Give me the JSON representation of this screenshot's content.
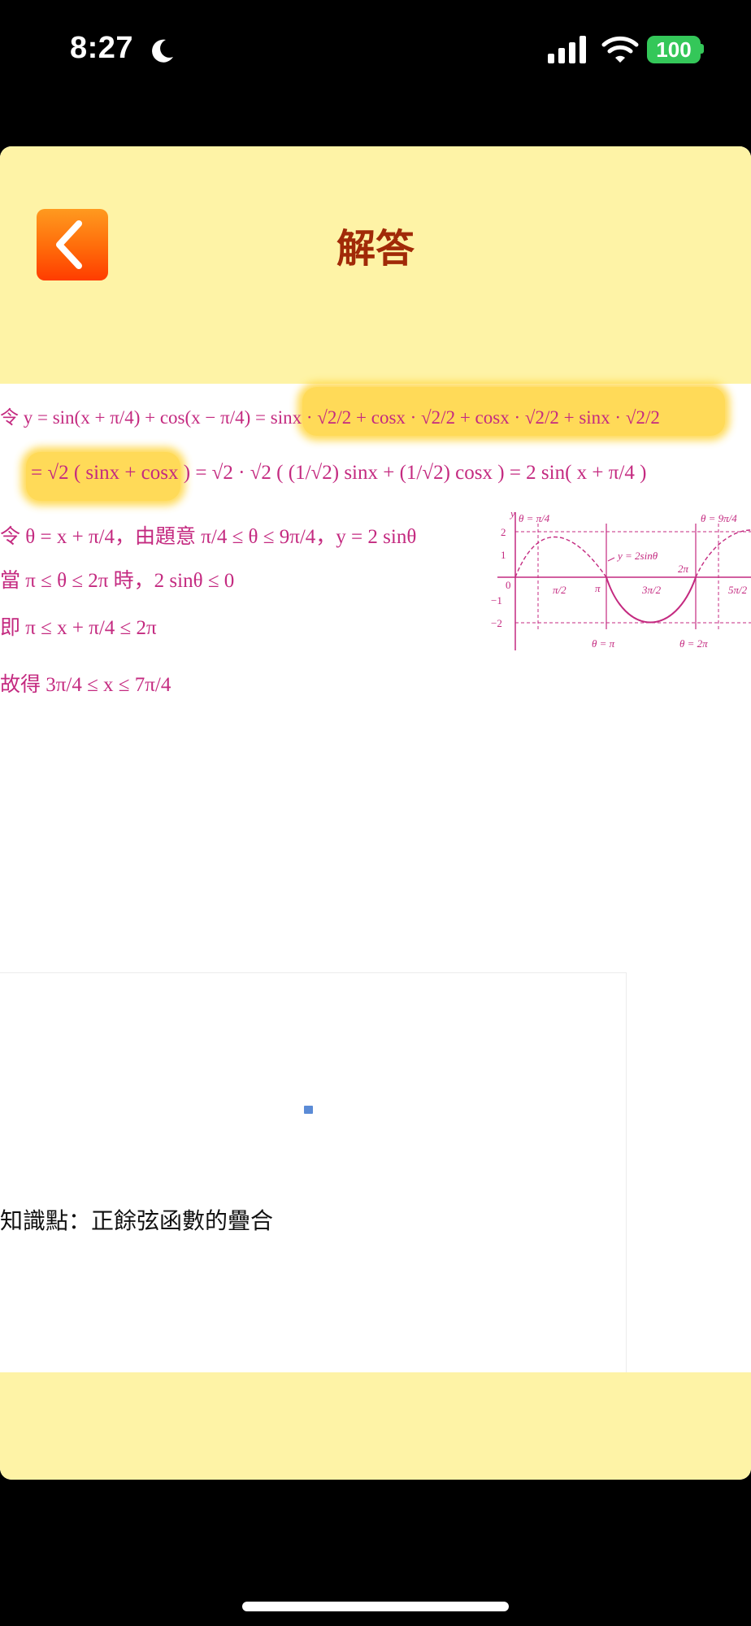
{
  "status_bar": {
    "time": "8:27",
    "battery": "100"
  },
  "header": {
    "title": "解答"
  },
  "solution": {
    "line1_lead": "令",
    "line1": "y = sin(x + π/4) + cos(x − π/4) = sinx · √2/2 + cosx · √2/2 + cosx · √2/2 + sinx · √2/2",
    "line2": "= √2 ( sinx + cosx ) = √2 · √2 ( (1/√2) sinx + (1/√2) cosx ) = 2 sin( x + π/4 )",
    "line3_lead": "令",
    "line3": "θ = x + π/4，由題意 π/4 ≤ θ ≤ 9π/4，y = 2 sinθ",
    "line4_lead": "當",
    "line4": "π ≤ θ ≤ 2π 時，2 sinθ ≤ 0",
    "line5_lead": "即",
    "line5": "π ≤ x + π/4 ≤ 2π",
    "line6_lead": "故得",
    "line6": "3π/4 ≤ x ≤ 7π/4"
  },
  "graph": {
    "y_axis": "y",
    "curve_label": "y = 2sinθ",
    "theta_top_left": "θ = π/4",
    "theta_top_right": "θ = 9π/4",
    "theta_bottom_left": "θ = π",
    "theta_bottom_right": "θ = 2π",
    "ticks_y": [
      "2",
      "1",
      "0",
      "−1",
      "−2"
    ],
    "ticks_x": [
      "π/2",
      "π",
      "3π/2",
      "2π",
      "5π/2"
    ]
  },
  "knowledge": {
    "text": "知識點：正餘弦函數的疊合"
  },
  "colors": {
    "header_bg": "#fef3a6",
    "title": "#a12a08",
    "math": "#c42a80",
    "highlight": "#ffd43b"
  }
}
